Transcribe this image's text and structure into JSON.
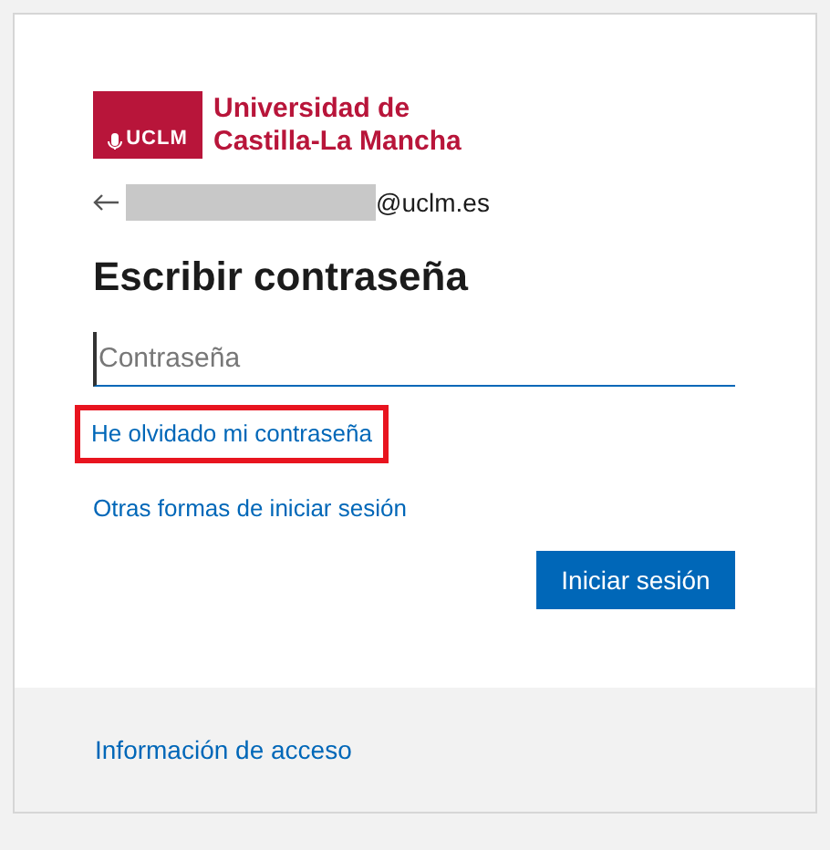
{
  "logo": {
    "badge": "UCLM",
    "name_lines": [
      "Universidad de",
      "Castilla-La Mancha"
    ]
  },
  "account": {
    "domain": "@uclm.es"
  },
  "title": "Escribir contraseña",
  "password_field": {
    "placeholder": "Contraseña"
  },
  "links": [
    {
      "label": "He olvidado mi contraseña",
      "highlighted": true
    },
    {
      "label": "Otras formas de iniciar sesión",
      "highlighted": false
    }
  ],
  "submit_button": "Iniciar sesión",
  "footer": {
    "link": "Información de acceso"
  }
}
